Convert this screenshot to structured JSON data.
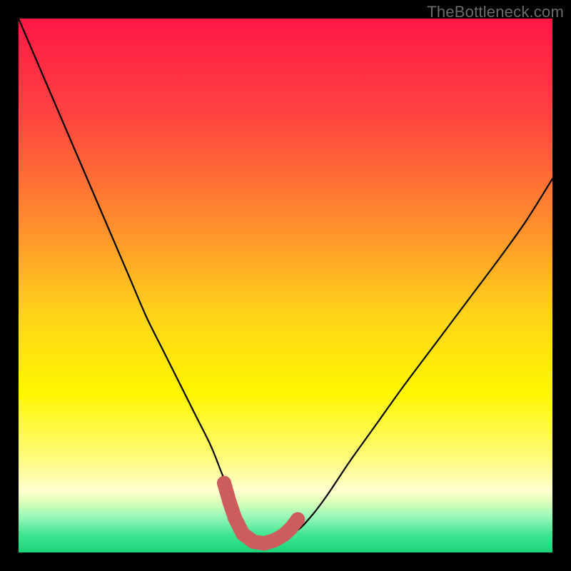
{
  "watermark": "TheBottleneck.com",
  "chart_data": {
    "type": "line",
    "title": "",
    "xlabel": "",
    "ylabel": "",
    "xlim": [
      0,
      100
    ],
    "ylim": [
      0,
      100
    ],
    "background_gradient": {
      "stops": [
        {
          "offset": 0.0,
          "color": "#ff1846"
        },
        {
          "offset": 0.18,
          "color": "#ff4341"
        },
        {
          "offset": 0.38,
          "color": "#ff8b2d"
        },
        {
          "offset": 0.55,
          "color": "#ffd21a"
        },
        {
          "offset": 0.7,
          "color": "#fff600"
        },
        {
          "offset": 0.82,
          "color": "#fffb78"
        },
        {
          "offset": 0.885,
          "color": "#ffffd0"
        },
        {
          "offset": 0.905,
          "color": "#dcffb8"
        },
        {
          "offset": 0.935,
          "color": "#93f7b8"
        },
        {
          "offset": 0.965,
          "color": "#43e693"
        },
        {
          "offset": 1.0,
          "color": "#17d47a"
        }
      ]
    },
    "series": [
      {
        "name": "bottleneck-curve",
        "color": "#000000",
        "width": 2.2,
        "x": [
          0,
          3,
          6,
          9,
          12,
          15,
          18,
          21,
          24,
          27,
          30,
          33,
          36,
          38,
          40,
          41.5,
          43,
          45,
          48,
          52,
          55,
          58,
          62,
          67,
          72,
          78,
          84,
          90,
          95,
          100
        ],
        "y": [
          100,
          93,
          86,
          79,
          72,
          65,
          58,
          51,
          44,
          38,
          32,
          26,
          20,
          15,
          10,
          6,
          3,
          1.5,
          2.5,
          4,
          7,
          11,
          17,
          24,
          31,
          39,
          47,
          55,
          62,
          70
        ]
      }
    ],
    "markers": {
      "name": "trough-dots",
      "color": "#cd5c5c",
      "radius": 10,
      "points": [
        {
          "x": 38.5,
          "y": 13.0
        },
        {
          "x": 39.5,
          "y": 9.5
        },
        {
          "x": 40.5,
          "y": 6.5
        },
        {
          "x": 42.0,
          "y": 3.5
        },
        {
          "x": 44.0,
          "y": 2.0
        },
        {
          "x": 46.0,
          "y": 1.7
        },
        {
          "x": 48.0,
          "y": 2.3
        },
        {
          "x": 49.7,
          "y": 3.3
        },
        {
          "x": 51.0,
          "y": 4.5
        },
        {
          "x": 52.3,
          "y": 6.2
        }
      ]
    }
  }
}
